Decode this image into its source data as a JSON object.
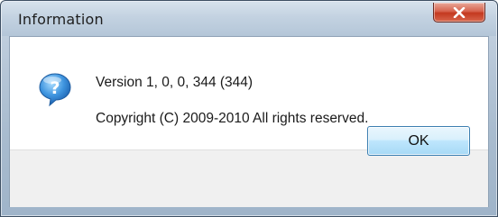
{
  "window": {
    "title": "Information",
    "close_icon": "close-x-icon"
  },
  "message": {
    "icon": "question-icon",
    "line1": "Version 1, 0, 0, 344 (344)",
    "line2": "Copyright (C) 2009-2010 All rights reserved."
  },
  "buttons": {
    "ok_label": "OK"
  },
  "colors": {
    "close_button": "#c4381f",
    "ok_button_border": "#3c7fb1",
    "icon_blue": "#2f7fd0"
  }
}
